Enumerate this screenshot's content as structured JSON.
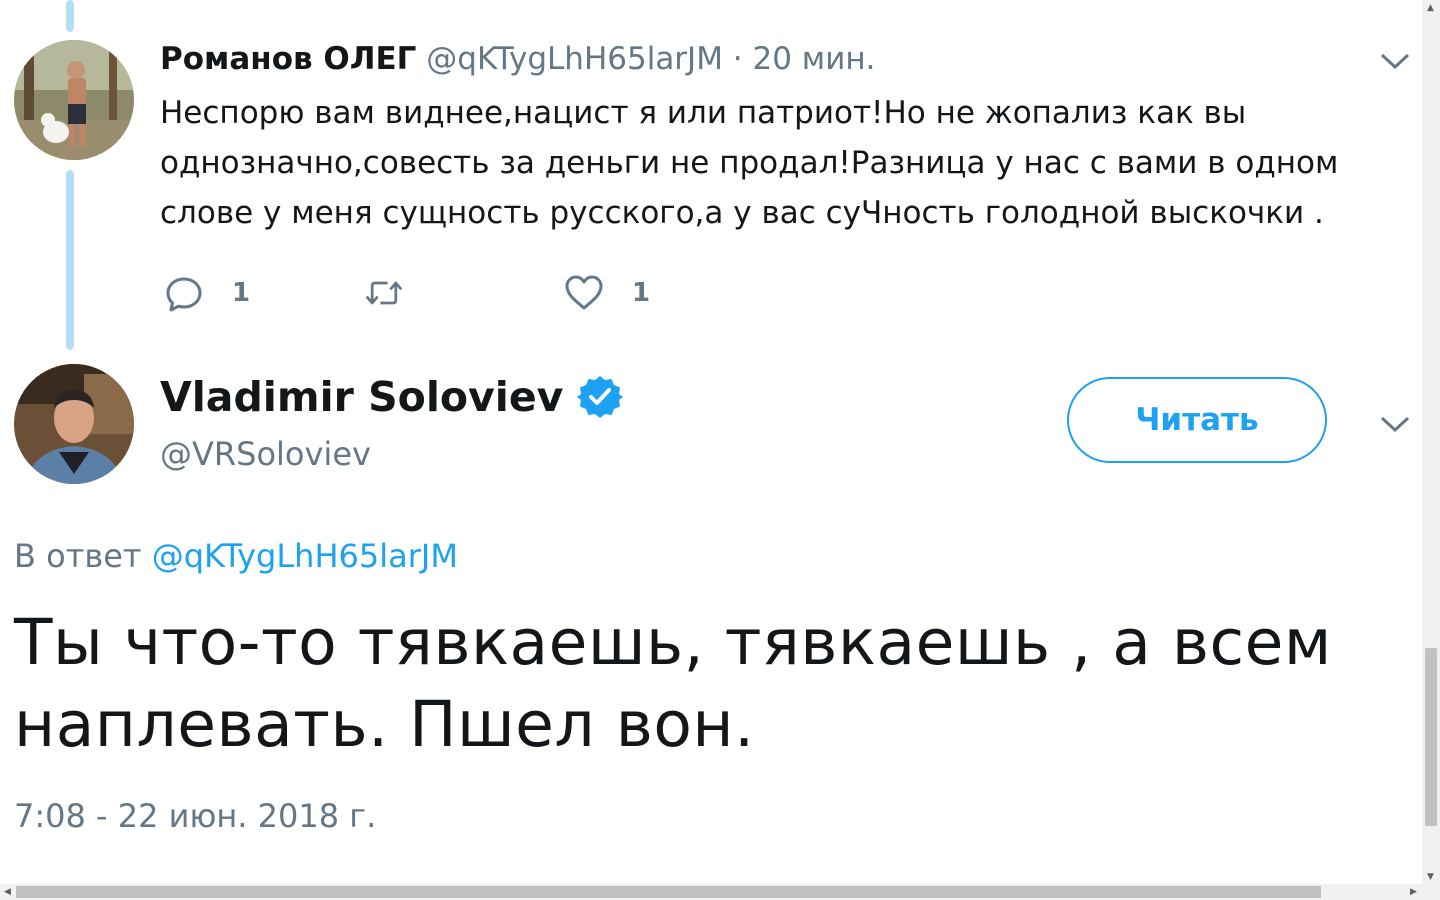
{
  "reply_tweet": {
    "name": "Романов ОЛЕГ",
    "handle_time": "@qKTygLhH65larJM · 20 мин.",
    "text_lines": [
      "Неспорю вам виднее,нацист я или патриот!Но не жопализ как вы",
      "однозначно,совесть за деньги не продал!Разница у нас с вами в одном",
      "слове у меня сущность русского,а у вас суЧность голодной выскочки ."
    ],
    "reply_count": "1",
    "like_count": "1"
  },
  "main_tweet": {
    "name": "Vladimir Soloviev",
    "handle": "@VRSoloviev",
    "follow_label": "Читать",
    "reply_to_prefix": "В ответ",
    "reply_to_handle": "@qKTygLhH65larJM",
    "text_lines": [
      "Ты что-то тявкаешь, тявкаешь , а всем",
      "наплевать. Пшел вон."
    ],
    "timestamp": "7:08 - 22 июн. 2018 г."
  },
  "colors": {
    "accent": "#1da1f2",
    "thread_line": "#b7def7",
    "muted_text": "#657786"
  },
  "icons": [
    "reply-icon",
    "retweet-icon",
    "like-icon",
    "chevron-down-icon",
    "verified-badge-icon"
  ]
}
